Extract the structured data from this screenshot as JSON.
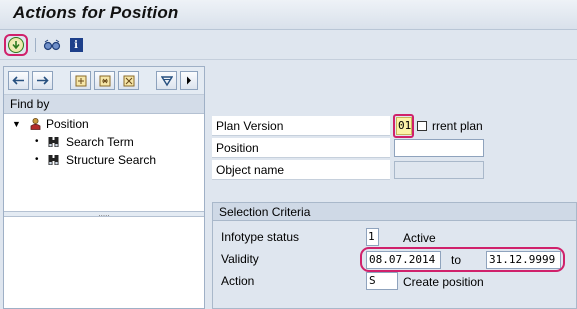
{
  "window": {
    "title": "Actions for Position"
  },
  "toolbar": {
    "execute_icon": "execute-icon",
    "glasses_icon": "display-glasses-icon",
    "info_icon": "info-icon",
    "info_glyph": "i"
  },
  "left_panel": {
    "nav_buttons": [
      "back-arrow-icon",
      "forward-arrow-icon",
      "expand-icon",
      "collapse-icon",
      "select-icon",
      "filter-icon",
      "more-icon"
    ],
    "find_by_label": "Find by",
    "tree": {
      "root": {
        "label": "Position"
      },
      "children": [
        {
          "label": "Search Term"
        },
        {
          "label": "Structure Search"
        }
      ]
    },
    "splitter_glyph": "....."
  },
  "form": {
    "plan_version": {
      "label": "Plan Version",
      "value": "01",
      "description": "rrent plan"
    },
    "position": {
      "label": "Position",
      "value": ""
    },
    "object_name": {
      "label": "Object name",
      "value": ""
    }
  },
  "selection_criteria": {
    "title": "Selection Criteria",
    "infotype_status": {
      "label": "Infotype status",
      "value": "1",
      "text": "Active"
    },
    "validity": {
      "label": "Validity",
      "from": "08.07.2014",
      "to_label": "to",
      "to": "31.12.9999"
    },
    "action": {
      "label": "Action",
      "value": "S",
      "text": "Create position"
    }
  },
  "colors": {
    "highlight": "#d0216b",
    "background": "#dfe6ef",
    "exec_green": "#2e7a1e"
  }
}
